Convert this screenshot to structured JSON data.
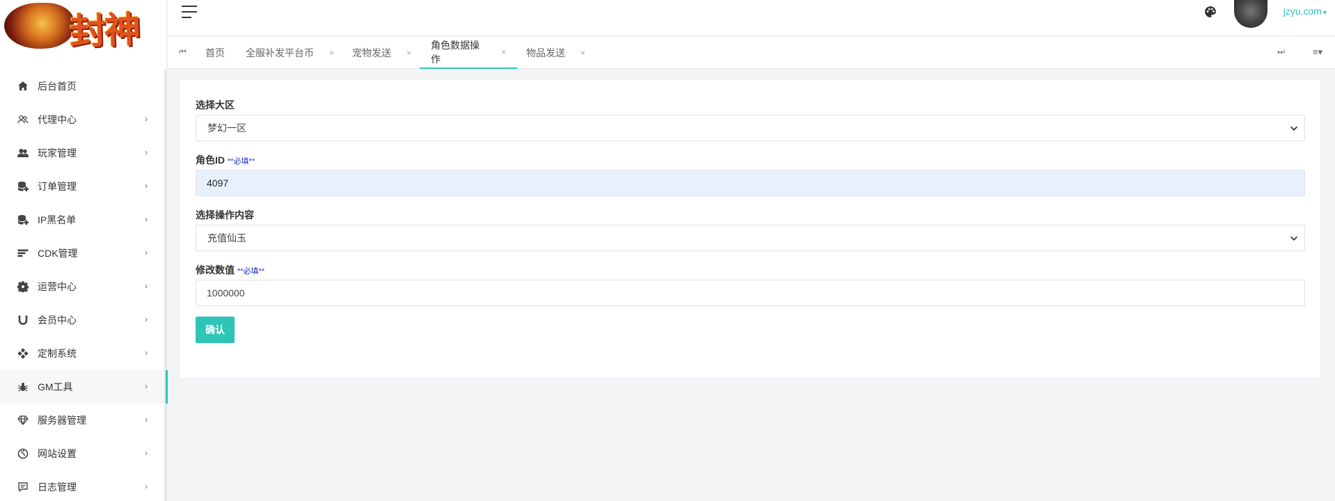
{
  "logo": {
    "text": "封神"
  },
  "header": {
    "menu_icon": "hamburger-icon",
    "theme_icon": "palette-icon",
    "username": "jzyu.com"
  },
  "sidebar": {
    "items": [
      {
        "label": "后台首页",
        "icon": "home-icon",
        "has_children": false
      },
      {
        "label": "代理中心",
        "icon": "users-icon",
        "has_children": true
      },
      {
        "label": "玩家管理",
        "icon": "group-icon",
        "has_children": true
      },
      {
        "label": "订单管理",
        "icon": "database-plus-icon",
        "has_children": true
      },
      {
        "label": "IP黑名单",
        "icon": "database-plus-icon",
        "has_children": true
      },
      {
        "label": "CDK管理",
        "icon": "sort-icon",
        "has_children": true
      },
      {
        "label": "运营中心",
        "icon": "gear-icon",
        "has_children": true
      },
      {
        "label": "会员中心",
        "icon": "magnet-icon",
        "has_children": true
      },
      {
        "label": "定制系统",
        "icon": "diamond-grid-icon",
        "has_children": true
      },
      {
        "label": "GM工具",
        "icon": "bug-icon",
        "has_children": true,
        "active": true
      },
      {
        "label": "服务器管理",
        "icon": "gem-icon",
        "has_children": true
      },
      {
        "label": "网站设置",
        "icon": "globe-icon",
        "has_children": true
      },
      {
        "label": "日志管理",
        "icon": "comment-icon",
        "has_children": true
      }
    ],
    "chevron": "›"
  },
  "tabs": {
    "prev_icon": "⏮",
    "next_icon": "⏭",
    "menu_icon": "≡▾",
    "close": "×",
    "items": [
      {
        "label": "首页",
        "closable": false
      },
      {
        "label": "全服补发平台币",
        "closable": true
      },
      {
        "label": "宠物发送",
        "closable": true
      },
      {
        "label": "角色数据操作",
        "closable": true,
        "active": true
      },
      {
        "label": "物品发送",
        "closable": true
      }
    ]
  },
  "form": {
    "zone": {
      "label": "选择大区",
      "value": "梦幻一区"
    },
    "role_id": {
      "label": "角色ID",
      "required": "**必填**",
      "value": "4097"
    },
    "operation": {
      "label": "选择操作内容",
      "value": "充值仙玉"
    },
    "amount": {
      "label": "修改数值",
      "required": "**必填**",
      "value": "1000000"
    },
    "submit_label": "确认"
  },
  "colors": {
    "accent": "#2ec5b6",
    "required_text": "#1d2cd6",
    "autofill_bg": "#e8f0fe"
  }
}
